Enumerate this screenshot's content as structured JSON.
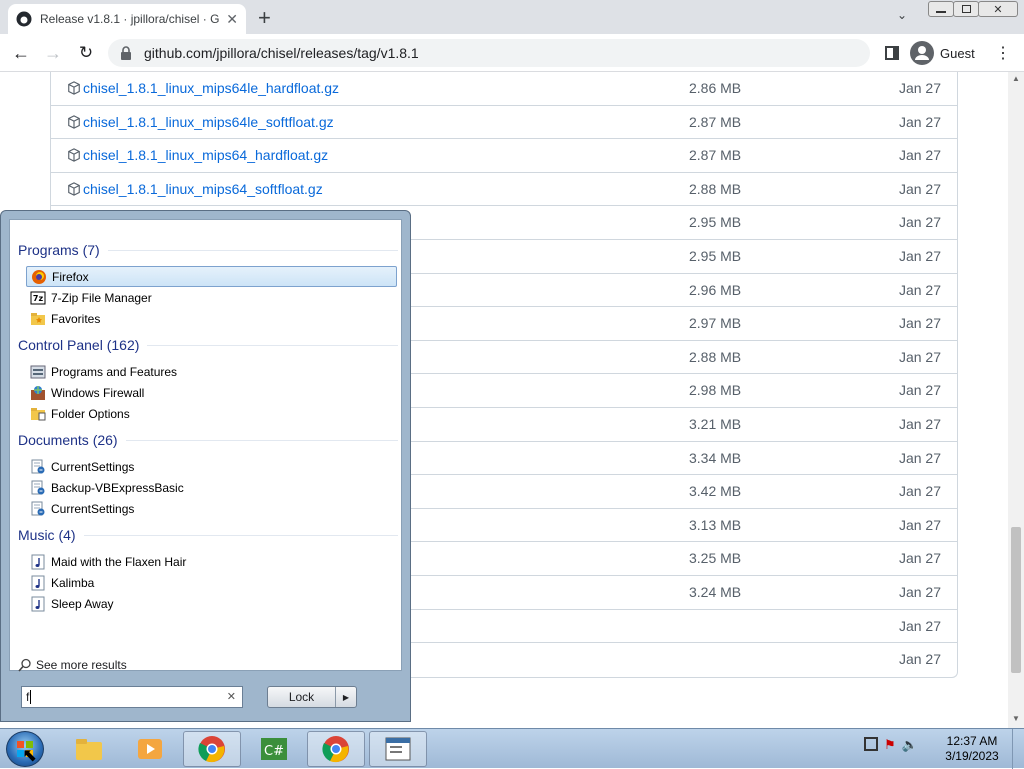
{
  "browser": {
    "tab_title": "Release v1.8.1 · jpillora/chisel · G",
    "url": "github.com/jpillora/chisel/releases/tag/v1.8.1",
    "profile": "Guest"
  },
  "assets": [
    {
      "name": "chisel_1.8.1_linux_mips64le_hardfloat.gz",
      "size": "2.86 MB",
      "date": "Jan 27"
    },
    {
      "name": "chisel_1.8.1_linux_mips64le_softfloat.gz",
      "size": "2.87 MB",
      "date": "Jan 27"
    },
    {
      "name": "chisel_1.8.1_linux_mips64_hardfloat.gz",
      "size": "2.87 MB",
      "date": "Jan 27"
    },
    {
      "name": "chisel_1.8.1_linux_mips64_softfloat.gz",
      "size": "2.88 MB",
      "date": "Jan 27"
    },
    {
      "name": "",
      "size": "2.95 MB",
      "date": "Jan 27"
    },
    {
      "name": "",
      "size": "2.95 MB",
      "date": "Jan 27"
    },
    {
      "name": "",
      "size": "2.96 MB",
      "date": "Jan 27"
    },
    {
      "name": "",
      "size": "2.97 MB",
      "date": "Jan 27"
    },
    {
      "name": "",
      "size": "2.88 MB",
      "date": "Jan 27"
    },
    {
      "name": "",
      "size": "2.98 MB",
      "date": "Jan 27"
    },
    {
      "name": "",
      "size": "3.21 MB",
      "date": "Jan 27"
    },
    {
      "name": "",
      "size": "3.34 MB",
      "date": "Jan 27"
    },
    {
      "name": "",
      "size": "3.42 MB",
      "date": "Jan 27"
    },
    {
      "name": "",
      "size": "3.13 MB",
      "date": "Jan 27"
    },
    {
      "name": "",
      "size": "3.25 MB",
      "date": "Jan 27"
    },
    {
      "name": "",
      "size": "3.24 MB",
      "date": "Jan 27"
    },
    {
      "name": "",
      "size": "",
      "date": "Jan 27"
    },
    {
      "name": "",
      "size": "",
      "date": "Jan 27"
    }
  ],
  "startmenu": {
    "groups": [
      {
        "title": "Programs (7)",
        "items": [
          {
            "label": "Firefox",
            "icon": "firefox-icon"
          },
          {
            "label": "7-Zip File Manager",
            "icon": "7zip-icon"
          },
          {
            "label": "Favorites",
            "icon": "folder-icon"
          }
        ]
      },
      {
        "title": "Control Panel (162)",
        "items": [
          {
            "label": "Programs and Features",
            "icon": "programs-features-icon"
          },
          {
            "label": "Windows Firewall",
            "icon": "firewall-icon"
          },
          {
            "label": "Folder Options",
            "icon": "folder-options-icon"
          }
        ]
      },
      {
        "title": "Documents (26)",
        "items": [
          {
            "label": "CurrentSettings",
            "icon": "document-icon"
          },
          {
            "label": "Backup-VBExpressBasic",
            "icon": "document-icon"
          },
          {
            "label": "CurrentSettings",
            "icon": "document-icon"
          }
        ]
      },
      {
        "title": "Music (4)",
        "items": [
          {
            "label": "Maid with the Flaxen Hair",
            "icon": "music-icon"
          },
          {
            "label": "Kalimba",
            "icon": "music-icon"
          },
          {
            "label": "Sleep Away",
            "icon": "music-icon"
          }
        ]
      }
    ],
    "see_more": "See more results",
    "search_value": "f",
    "lock_label": "Lock"
  },
  "clock": {
    "time": "12:37 AM",
    "date": "3/19/2023"
  },
  "colors": {
    "link": "#0969da",
    "group_title": "#1e3287"
  }
}
